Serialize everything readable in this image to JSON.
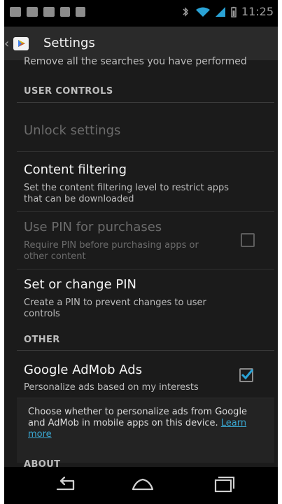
{
  "status_bar": {
    "time": "11:25"
  },
  "action_bar": {
    "back_glyph": "‹",
    "title": "Settings",
    "app_icon": "google-play-icon"
  },
  "content": {
    "cut_text": "Remove all the searches you have performed",
    "sections": [
      {
        "title": "USER CONTROLS"
      },
      {
        "title": "OTHER"
      },
      {
        "title": "ABOUT"
      }
    ],
    "items": [
      {
        "title": "Unlock settings",
        "subtitle": "",
        "enabled": false
      },
      {
        "title": "Content filtering",
        "subtitle": "Set the content filtering level to restrict apps that can be downloaded",
        "enabled": true
      },
      {
        "title": "Use PIN for purchases",
        "subtitle": "Require PIN before purchasing apps or other content",
        "enabled": false,
        "checked": false
      },
      {
        "title": "Set or change PIN",
        "subtitle": "Create a PIN to prevent changes to user controls",
        "enabled": true
      },
      {
        "title": "Google AdMob Ads",
        "subtitle": "Personalize ads based on my interests",
        "enabled": true,
        "checked": true
      }
    ],
    "info": {
      "text": "Choose whether to personalize ads from Google and AdMob in mobile apps on this device. ",
      "link_text": "Learn more"
    }
  },
  "nav": {
    "back_icon": "back-icon",
    "home_icon": "home-icon",
    "recent_icon": "recent-apps-icon"
  },
  "colors": {
    "accent": "#3aa7d1",
    "background": "#1b1b1b"
  }
}
